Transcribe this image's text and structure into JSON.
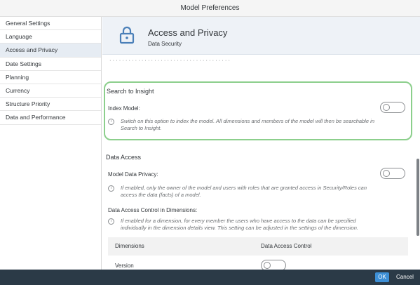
{
  "window": {
    "title": "Model Preferences"
  },
  "sidebar": {
    "items": [
      {
        "label": "General Settings",
        "active": false
      },
      {
        "label": "Language",
        "active": false
      },
      {
        "label": "Access and Privacy",
        "active": true
      },
      {
        "label": "Date Settings",
        "active": false
      },
      {
        "label": "Planning",
        "active": false
      },
      {
        "label": "Currency",
        "active": false
      },
      {
        "label": "Structure Priority",
        "active": false
      },
      {
        "label": "Data and Performance",
        "active": false
      }
    ]
  },
  "header": {
    "icon": "lock-icon",
    "title": "Access and Privacy",
    "subtitle": "Data Security"
  },
  "search_insight": {
    "title": "Search to Insight",
    "index_label": "Index Model:",
    "index_enabled": false,
    "index_info": "Switch on this option to index the model. All dimensions and members of the model will then be searchable in",
    "index_info_2": "Search to Insight."
  },
  "data_access": {
    "title": "Data Access",
    "privacy_label": "Model Data Privacy:",
    "privacy_enabled": false,
    "privacy_info": "If enabled, only the owner of the model and users with roles that are granted access in Security/Roles can",
    "privacy_info_2": "access the data (facts) of a model.",
    "dac_label": "Data Access Control in Dimensions:",
    "dac_info": "If enabled for a dimension, for every member the users who have access to the data can be specified",
    "dac_info_2": "individually in the dimension details view. This setting can be adjusted in the settings of the dimension.",
    "table": {
      "columns": [
        "Dimensions",
        "Data Access Control"
      ],
      "rows": [
        {
          "dimension": "Version",
          "enabled": false
        }
      ]
    }
  },
  "footer": {
    "ok_label": "OK",
    "cancel_label": "Cancel"
  },
  "colors": {
    "accent": "#3d8fd6",
    "highlight": "#8ccf8c",
    "footer": "#2b3a47",
    "active_item": "#e6ecf3"
  }
}
